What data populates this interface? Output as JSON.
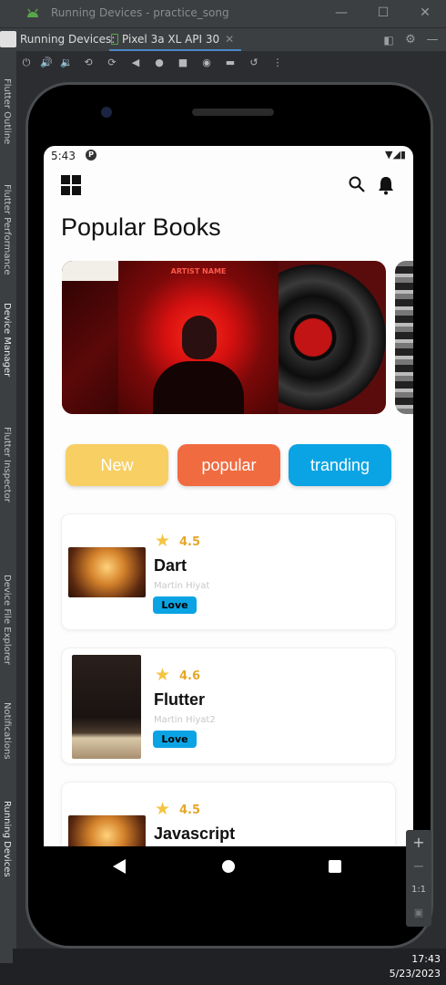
{
  "window": {
    "title": "Running Devices - practice_song"
  },
  "tabbar": {
    "running_label": "Running Devices:",
    "device_tab": "Pixel 3a XL API 30"
  },
  "side_panels": [
    "Flutter Outline",
    "Flutter Performance",
    "Device Manager",
    "Flutter Inspector",
    "Device File Explorer",
    "Notifications",
    "Running Devices"
  ],
  "phone": {
    "status": {
      "time": "5:43"
    },
    "heading": "Popular Books",
    "banner": {
      "artist_label": "ARTIST NAME"
    },
    "chips": [
      {
        "label": "New",
        "color": "#f8cf63"
      },
      {
        "label": "popular",
        "color": "#f16b40"
      },
      {
        "label": "tranding",
        "color": "#0aa4e4"
      }
    ],
    "books": [
      {
        "rating": "4.5",
        "name": "Dart",
        "author": "Martin Hiyat",
        "tag": "Love"
      },
      {
        "rating": "4.6",
        "name": "Flutter",
        "author": "Martin Hiyat2",
        "tag": "Love"
      },
      {
        "rating": "4.5",
        "name": "Javascript",
        "author": "",
        "tag": ""
      }
    ]
  },
  "zoom": {
    "plus": "+",
    "minus": "−",
    "ratio": "1:1"
  },
  "taskbar": {
    "time": "17:43",
    "date": "5/23/2023"
  }
}
